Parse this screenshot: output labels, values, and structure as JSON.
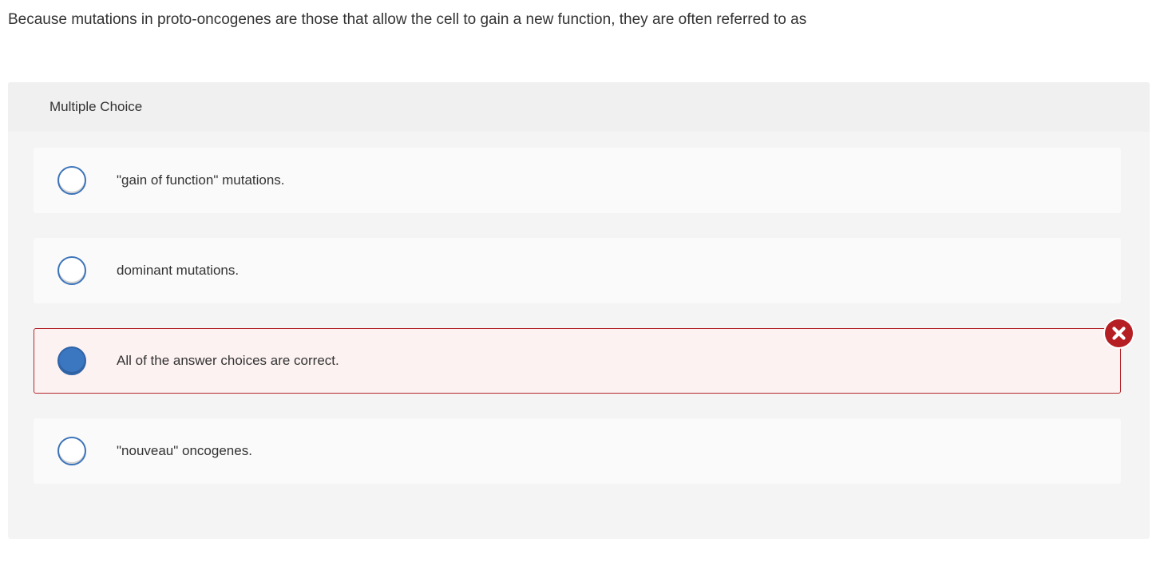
{
  "question": {
    "text": "Because mutations in proto-oncogenes are those that allow the cell to gain a new function, they are often referred to as"
  },
  "multiple_choice": {
    "header_label": "Multiple Choice",
    "selected_index": 2,
    "selected_result": "incorrect",
    "result_icon": "x-circle-icon",
    "colors": {
      "radio_selected": "#3b76c1",
      "radio_border": "#3b73b9",
      "incorrect": "#b51f24",
      "incorrect_bg": "#fdf2f2"
    },
    "choices": [
      {
        "label": "\"gain of function\" mutations.",
        "selected": false
      },
      {
        "label": "dominant mutations.",
        "selected": false
      },
      {
        "label": "All of the answer choices are correct.",
        "selected": true
      },
      {
        "label": "\"nouveau\" oncogenes.",
        "selected": false
      }
    ]
  }
}
